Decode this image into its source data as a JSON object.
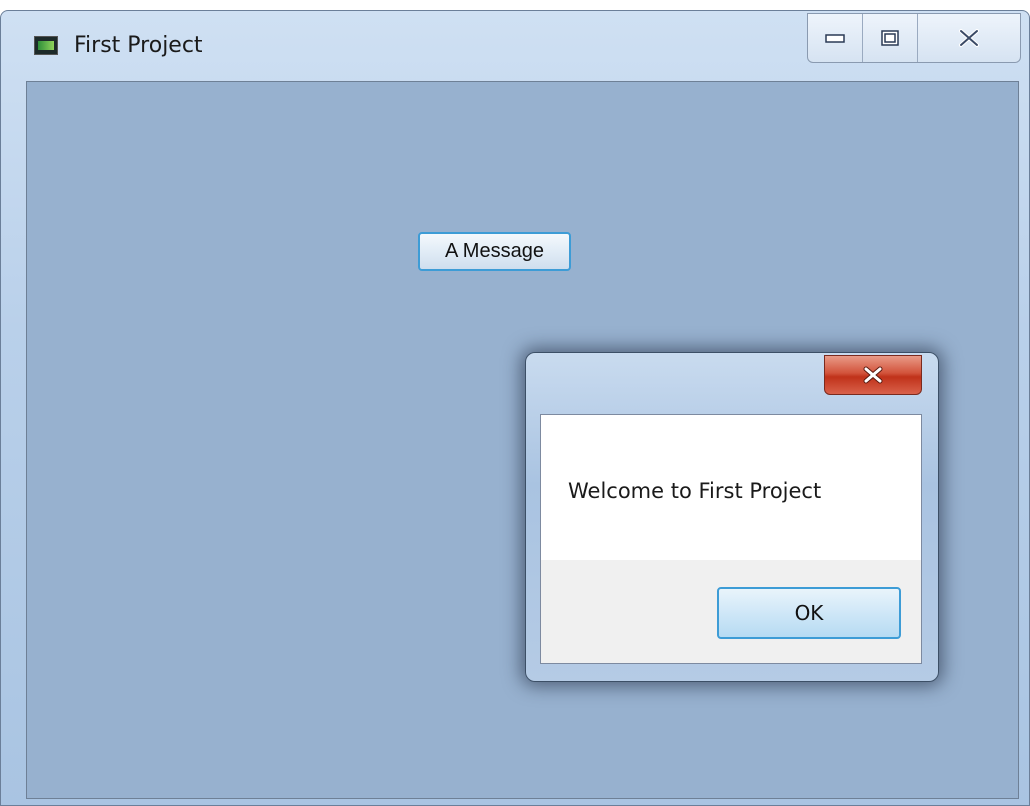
{
  "window": {
    "title": "First Project",
    "icon": "app-icon",
    "caption_buttons": [
      {
        "icon": "minimize-icon"
      },
      {
        "icon": "maximize-icon"
      },
      {
        "icon": "close-icon"
      }
    ]
  },
  "main": {
    "message_button_label": "A Message"
  },
  "message_box": {
    "text": "Welcome to First Project",
    "ok_label": "OK",
    "close_icon": "close-icon"
  },
  "colors": {
    "client_background": "#97b1cf",
    "focus_border": "#3d9cd6",
    "close_button_red": "#c0321a"
  }
}
